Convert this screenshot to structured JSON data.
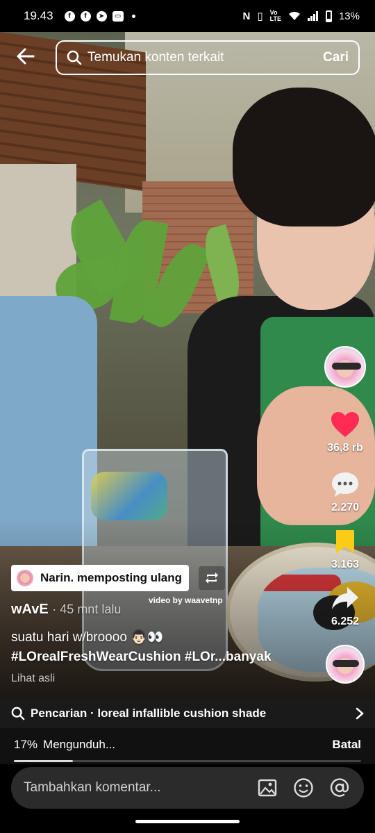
{
  "status_bar": {
    "time": "19.43",
    "battery": "13%",
    "notification_icons": [
      "facebook-icon",
      "facebook-icon",
      "telegram-icon",
      "app-icon"
    ]
  },
  "search": {
    "placeholder": "Temukan konten terkait",
    "button_label": "Cari"
  },
  "rail": {
    "likes": "36,8 rb",
    "comments": "2.270",
    "saves": "3.163",
    "shares": "6.252"
  },
  "video": {
    "repost_label": "Narin. memposting ulang",
    "watermark": "video by waavetnp",
    "author": "wAvE",
    "time_ago": "· 45 mnt lalu",
    "caption_line1": "suatu hari w/broooo 👨🏻👀",
    "caption_line2_tags": "#LOrealFreshWearCushion #LOr...",
    "caption_more": "banyak",
    "see_original": "Lihat asli"
  },
  "suggestion": {
    "text": "Pencarian · loreal infallible cushion shade"
  },
  "download": {
    "percent_label": "17%",
    "progress": 0.17,
    "label": "Mengunduh...",
    "cancel_label": "Batal"
  },
  "comment_bar": {
    "placeholder": "Tambahkan komentar..."
  },
  "colors": {
    "like": "#fe2c55",
    "save": "#facc15"
  }
}
